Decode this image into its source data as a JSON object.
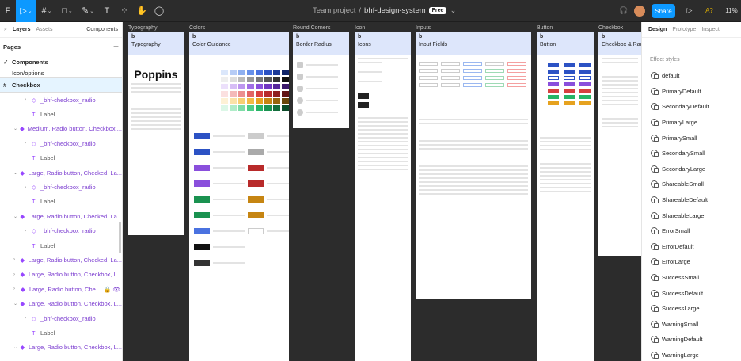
{
  "toolbar": {
    "figma_icon": "F",
    "move_icon": "▷",
    "frame_icon": "#",
    "shape_icon": "□",
    "pen_icon": "✎",
    "text_icon": "T",
    "components_icon": "⁘",
    "hand_icon": "✋",
    "comment_icon": "◯",
    "chevron": "⌄",
    "headphones_icon": "🎧",
    "avatar_icon": "●",
    "share_label": "Share",
    "play_icon": "▷",
    "ai_label": "A?",
    "zoom": "11%"
  },
  "breadcrumb": {
    "team": "Team project",
    "sep": "/",
    "file": "bhf-design-system",
    "plan_badge": "Free",
    "chevron": "⌄"
  },
  "left": {
    "tabs": [
      "Layers",
      "Assets"
    ],
    "components_label": "Components",
    "pages_label": "Pages",
    "plus": "+",
    "page_items": [
      "Components",
      "Icon/options"
    ],
    "selected_layer": "Checkbox",
    "layers": [
      {
        "label": "_bhf-checkbox_radio",
        "arrow": "›",
        "icon": "◇",
        "indent": 31,
        "color": "purple"
      },
      {
        "label": "Label",
        "arrow": "",
        "icon": "T",
        "indent": 31,
        "color": "gray"
      },
      {
        "label": "Medium, Radio button, Checkbox,...",
        "arrow": "⌄",
        "icon": "◆",
        "indent": 17,
        "color": "purple"
      },
      {
        "label": "_bhf-checkbox_radio",
        "arrow": "›",
        "icon": "◇",
        "indent": 31,
        "color": "purple"
      },
      {
        "label": "Label",
        "arrow": "",
        "icon": "T",
        "indent": 31,
        "color": "gray"
      },
      {
        "label": "Large, Radio button, Checked, La...",
        "arrow": "⌄",
        "icon": "◆",
        "indent": 17,
        "color": "purple"
      },
      {
        "label": "_bhf-checkbox_radio",
        "arrow": "›",
        "icon": "◇",
        "indent": 31,
        "color": "purple"
      },
      {
        "label": "Label",
        "arrow": "",
        "icon": "T",
        "indent": 31,
        "color": "gray"
      },
      {
        "label": "Large, Radio button, Checked, La...",
        "arrow": "⌄",
        "icon": "◆",
        "indent": 17,
        "color": "purple"
      },
      {
        "label": "_bhf-checkbox_radio",
        "arrow": "›",
        "icon": "◇",
        "indent": 31,
        "color": "purple"
      },
      {
        "label": "Label",
        "arrow": "",
        "icon": "T",
        "indent": 31,
        "color": "gray"
      },
      {
        "label": "Large, Radio button, Checked, La...",
        "arrow": "›",
        "icon": "◆",
        "indent": 17,
        "color": "purple"
      },
      {
        "label": "Large, Radio button, Checkbox, L...",
        "arrow": "›",
        "icon": "◆",
        "indent": 17,
        "color": "purple"
      },
      {
        "label": "Large, Radio button, Che...",
        "arrow": "›",
        "icon": "◆",
        "indent": 17,
        "color": "purple",
        "extra": "🔒 👁"
      },
      {
        "label": "Large, Radio button, Checkbox, L...",
        "arrow": "⌄",
        "icon": "◆",
        "indent": 17,
        "color": "purple"
      },
      {
        "label": "_bhf-checkbox_radio",
        "arrow": "›",
        "icon": "◇",
        "indent": 31,
        "color": "purple"
      },
      {
        "label": "Label",
        "arrow": "",
        "icon": "T",
        "indent": 31,
        "color": "gray"
      },
      {
        "label": "Large, Radio button, Checkbox, L...",
        "arrow": "⌄",
        "icon": "◆",
        "indent": 17,
        "color": "purple"
      }
    ]
  },
  "canvas": {
    "frames": [
      {
        "name": "Typography",
        "logo": "b",
        "title": "Typography",
        "big": "Poppins"
      },
      {
        "name": "Colors",
        "logo": "b",
        "title": "Color Guidance"
      },
      {
        "name": "Round Corners",
        "logo": "b",
        "title": "Border Radius"
      },
      {
        "name": "Icon",
        "logo": "b",
        "title": "Icons"
      },
      {
        "name": "Inputs",
        "logo": "b",
        "title": "Input Fields"
      },
      {
        "name": "Button",
        "logo": "b",
        "title": "Button"
      },
      {
        "name": "Checkbox",
        "logo": "b",
        "title": "Checkbox & Radio B"
      }
    ]
  },
  "right": {
    "tabs": [
      "Design",
      "Prototype",
      "Inspect"
    ],
    "section": "Effect styles",
    "styles": [
      "default",
      "PrimaryDefault",
      "SecondaryDefault",
      "PrimaryLarge",
      "PrimarySmall",
      "SecondarySmall",
      "SecondaryLarge",
      "ShareableSmall",
      "ShareableDefault",
      "ShareableLarge",
      "ErrorSmall",
      "ErrorDefault",
      "ErrorLarge",
      "SuccessSmall",
      "SuccessDefault",
      "SuccessLarge",
      "WarningSmall",
      "WarningDefault",
      "WarningLarge"
    ]
  },
  "colors": {
    "accent": "#0d99ff",
    "component_purple": "#9747ff",
    "frame_header": "#dde6fb"
  }
}
